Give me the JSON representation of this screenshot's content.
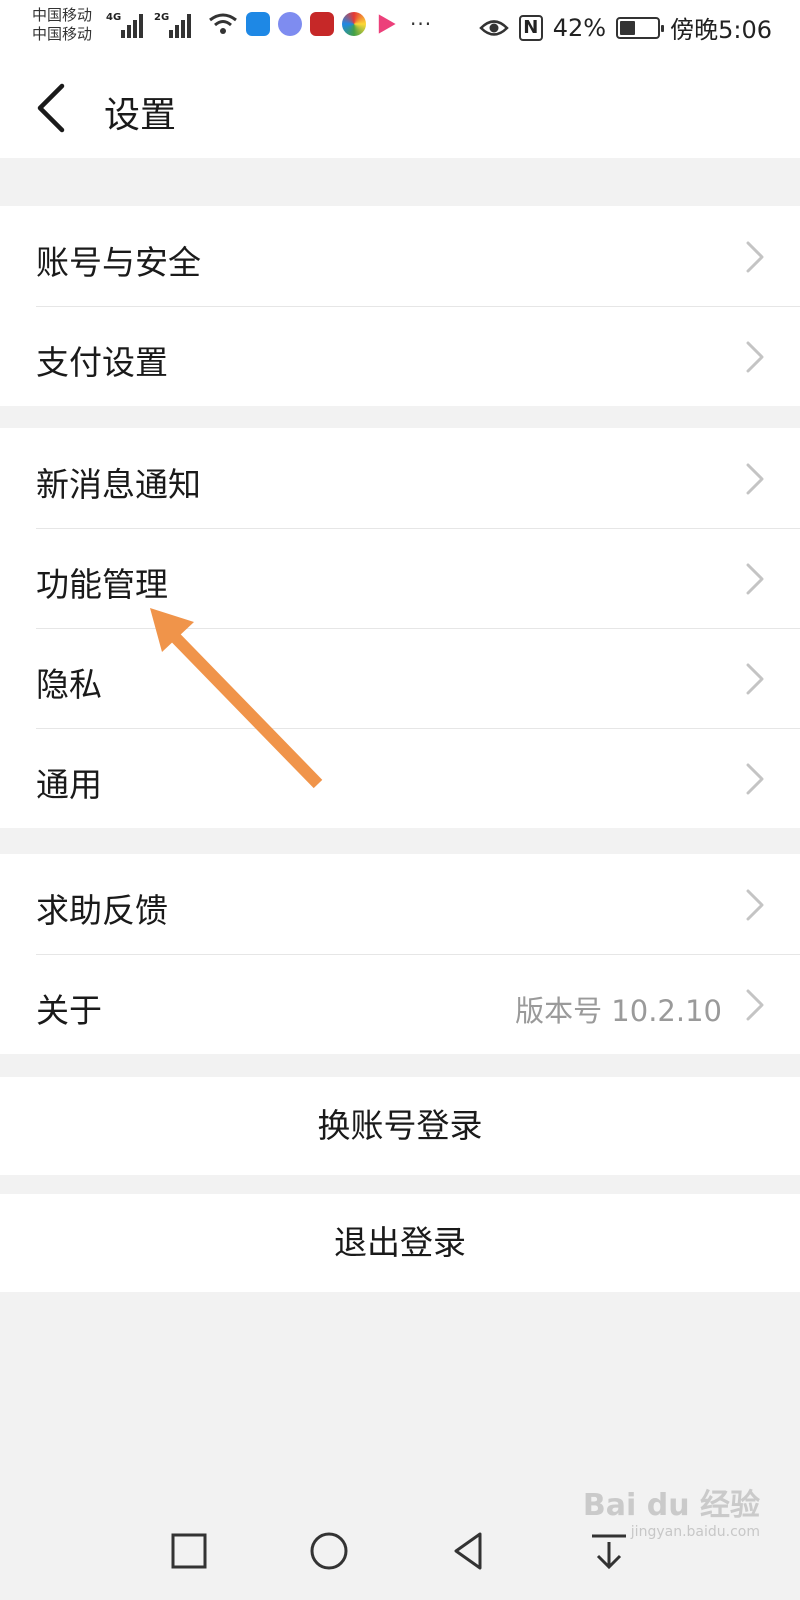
{
  "status_bar": {
    "carrier_1": "中国移动",
    "carrier_2": "中国移动",
    "net_1": "4G",
    "net_2": "2G",
    "battery_percent": "42%",
    "battery_level": 0.42,
    "time": "傍晚5:06",
    "nfc_label": "N",
    "more": "···",
    "icons": [
      "signal-icon",
      "wifi-icon",
      "shield-app-icon",
      "music-app-icon",
      "weibo-app-icon",
      "browser-app-icon",
      "video-app-icon",
      "eye-icon",
      "nfc-icon",
      "battery-icon"
    ]
  },
  "header": {
    "title": "设置"
  },
  "groups": [
    {
      "items": [
        {
          "label": "账号与安全"
        },
        {
          "label": "支付设置"
        }
      ]
    },
    {
      "items": [
        {
          "label": "新消息通知"
        },
        {
          "label": "功能管理"
        },
        {
          "label": "隐私"
        },
        {
          "label": "通用"
        }
      ]
    },
    {
      "items": [
        {
          "label": "求助反馈"
        },
        {
          "label": "关于",
          "value": "版本号 10.2.10"
        }
      ]
    }
  ],
  "actions": {
    "switch_account": "换账号登录",
    "logout": "退出登录"
  },
  "annotation": {
    "color": "#f0944a",
    "target": "功能管理"
  },
  "watermark": {
    "brand": "Bai du 经验",
    "url": "jingyan.baidu.com"
  }
}
